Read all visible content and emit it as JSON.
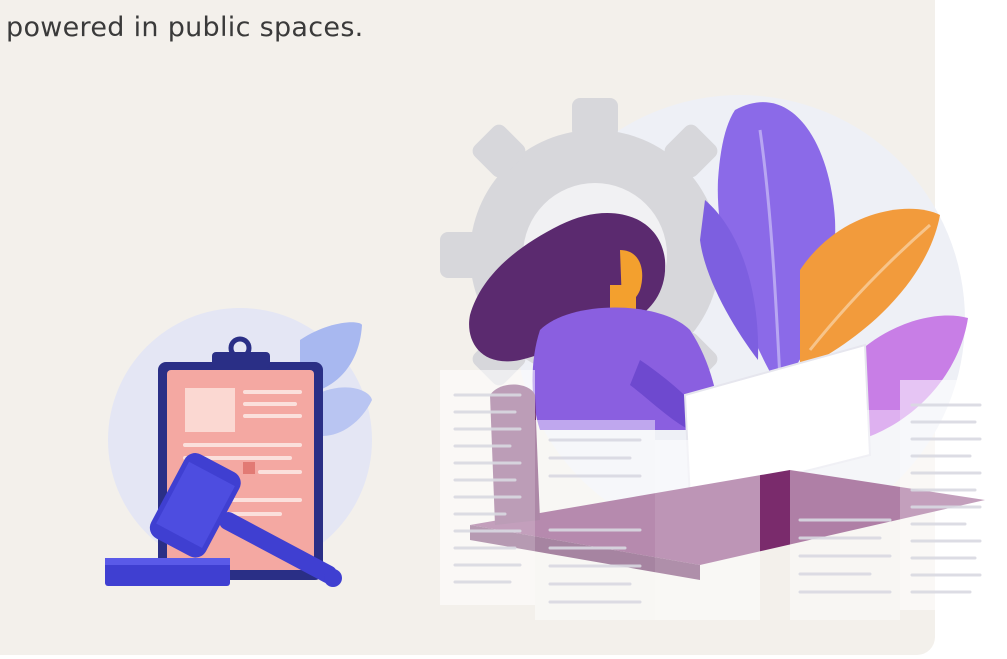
{
  "description": {
    "line_cut": "",
    "line_visible": "powered in public spaces."
  },
  "illustrations": {
    "left": {
      "name": "clipboard-with-gavel-illustration"
    },
    "right": {
      "name": "woman-at-computer-illustration"
    }
  },
  "colors": {
    "card_bg": "#f3f0eb",
    "page_bg": "#ffffff",
    "text": "#3a3a3a",
    "gavel": "#3f3fd1",
    "clipboard_frame": "#2a2f86",
    "clipboard_paper": "#f4a8a2",
    "leaf_purple": "#8b6ae8",
    "leaf_orange": "#f29b3c",
    "leaf_pink": "#c87ee6",
    "hair": "#5b2a6f",
    "desk": "#7a2b6c",
    "gear": "#d7d7db"
  }
}
